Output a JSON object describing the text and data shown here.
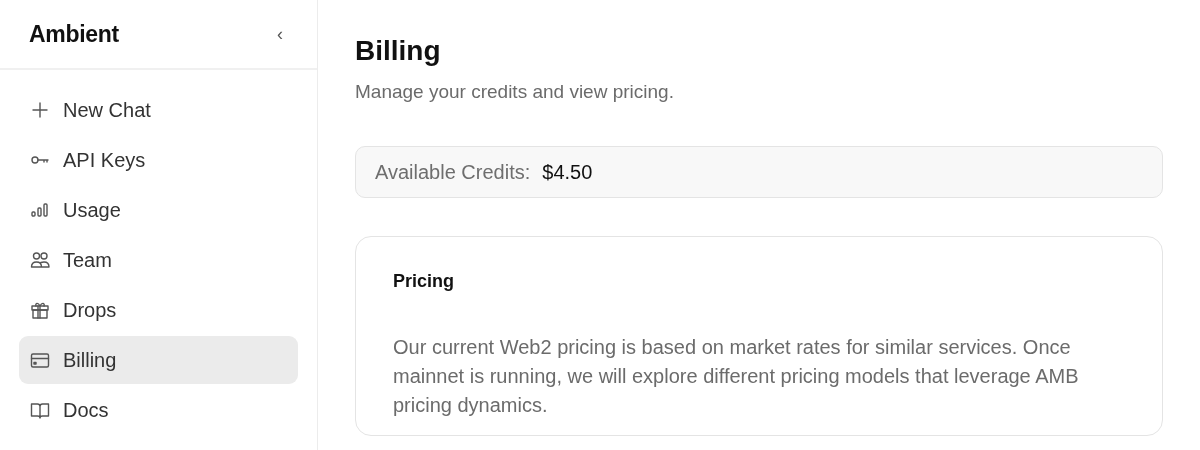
{
  "sidebar": {
    "brand": "Ambient",
    "collapse_icon": "‹",
    "items": [
      {
        "label": "New Chat",
        "selected": false
      },
      {
        "label": "API Keys",
        "selected": false
      },
      {
        "label": "Usage",
        "selected": false
      },
      {
        "label": "Team",
        "selected": false
      },
      {
        "label": "Drops",
        "selected": false
      },
      {
        "label": "Billing",
        "selected": true
      },
      {
        "label": "Docs",
        "selected": false
      }
    ]
  },
  "page": {
    "title": "Billing",
    "subtitle": "Manage your credits and view pricing.",
    "credits": {
      "label": "Available Credits:",
      "value": "$4.50"
    },
    "pricing": {
      "title": "Pricing",
      "text": "Our current Web2 pricing is based on market rates for similar services. Once mainnet is running, we will explore different pricing models that leverage AMB pricing dynamics."
    }
  }
}
